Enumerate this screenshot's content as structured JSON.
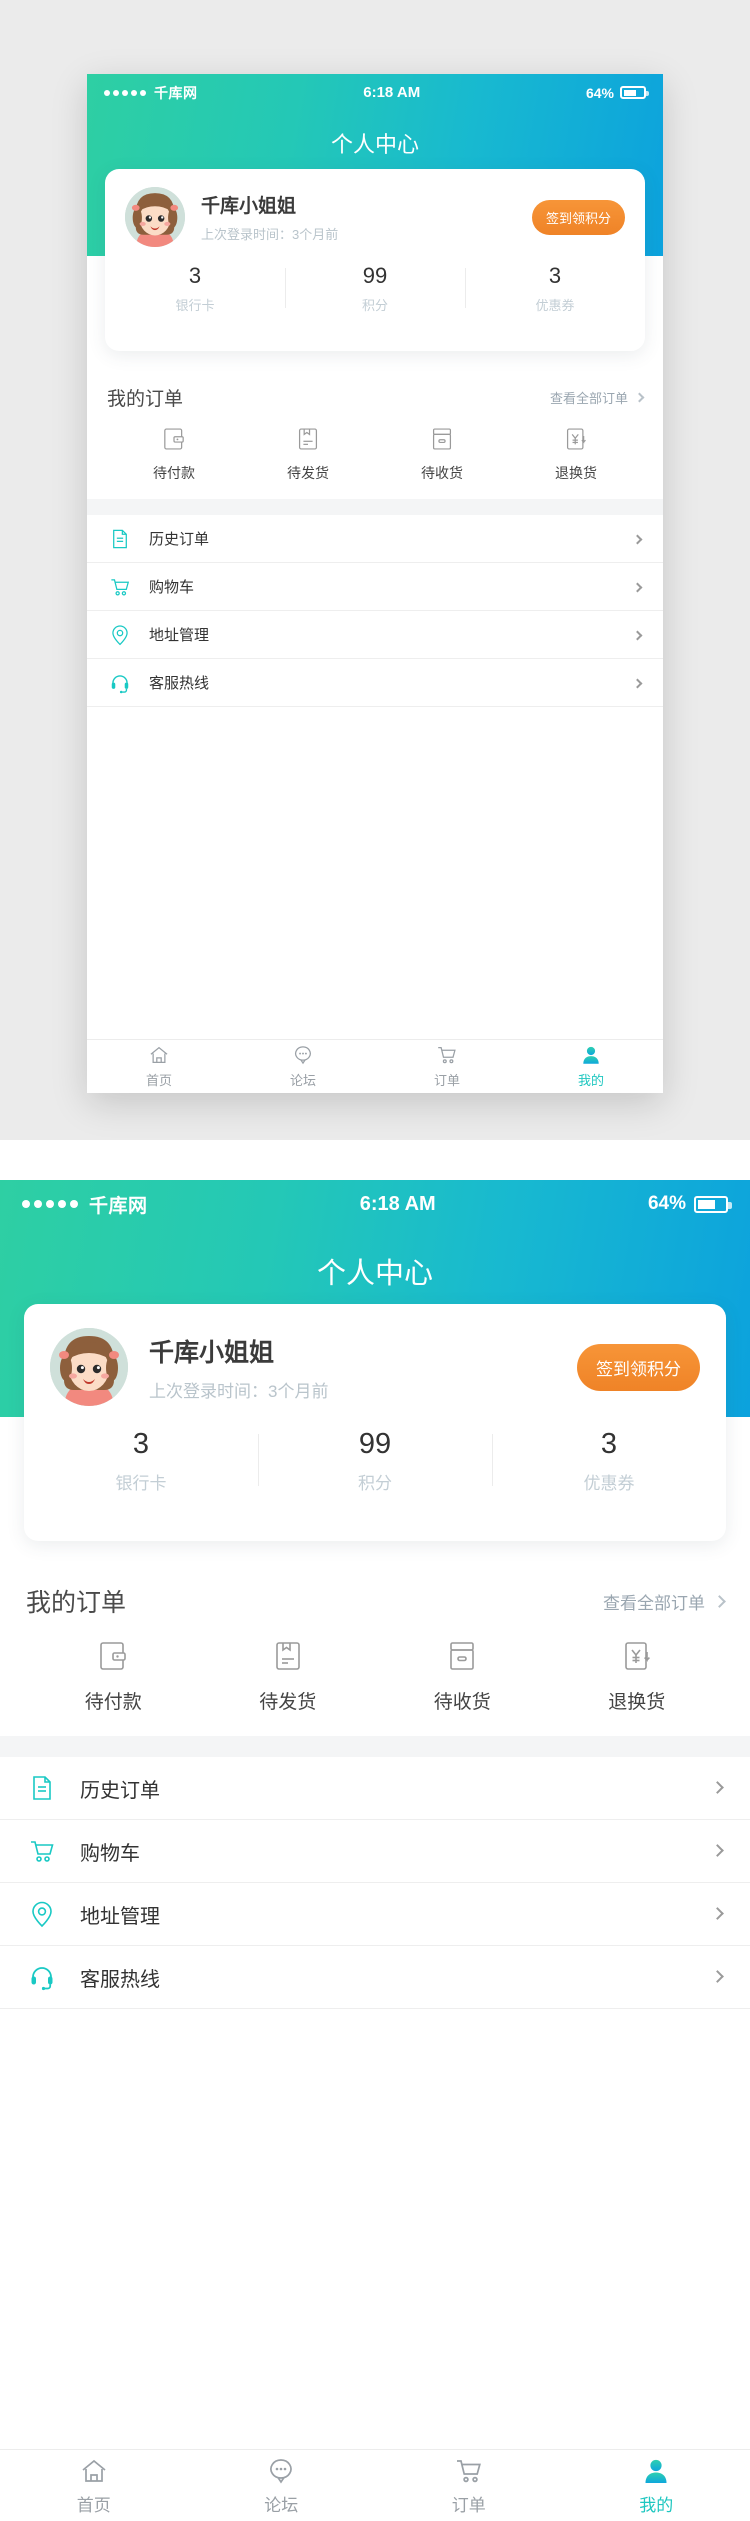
{
  "theme": {
    "gradient_start": "#2ecfa3",
    "gradient_end": "#0ca2dd",
    "accent_orange": "#ef8327",
    "active_tab_color": "#1fc7c0",
    "icon_gray": "#9a9a9a",
    "page_background": "#ebebeb"
  },
  "status_bar": {
    "signal_dots": 5,
    "carrier": "千库网",
    "time": "6:18 AM",
    "battery_percent": "64%",
    "battery_level": 64
  },
  "nav": {
    "title": "个人中心"
  },
  "profile": {
    "avatar_alt": "girl-avatar",
    "name": "千库小姐姐",
    "last_login": "上次登录时间：3个月前",
    "sign_in_button": "签到领积分",
    "stats": [
      {
        "value": "3",
        "label": "银行卡"
      },
      {
        "value": "99",
        "label": "积分"
      },
      {
        "value": "3",
        "label": "优惠券"
      }
    ]
  },
  "orders": {
    "title": "我的订单",
    "view_all": "查看全部订单",
    "items": [
      {
        "label": "待付款",
        "icon": "wallet-icon"
      },
      {
        "label": "待发货",
        "icon": "package-icon"
      },
      {
        "label": "待收货",
        "icon": "box-icon"
      },
      {
        "label": "退换货",
        "icon": "refund-yen-icon"
      }
    ]
  },
  "menu": {
    "items": [
      {
        "label": "历史订单",
        "icon": "document-icon"
      },
      {
        "label": "购物车",
        "icon": "cart-icon"
      },
      {
        "label": "地址管理",
        "icon": "location-pin-icon"
      },
      {
        "label": "客服热线",
        "icon": "headset-icon"
      }
    ]
  },
  "tabbar": {
    "items": [
      {
        "label": "首页",
        "icon": "home-icon",
        "active": false
      },
      {
        "label": "论坛",
        "icon": "chat-bubble-icon",
        "active": false
      },
      {
        "label": "订单",
        "icon": "cart-icon",
        "active": false
      },
      {
        "label": "我的",
        "icon": "person-icon",
        "active": true
      }
    ]
  }
}
